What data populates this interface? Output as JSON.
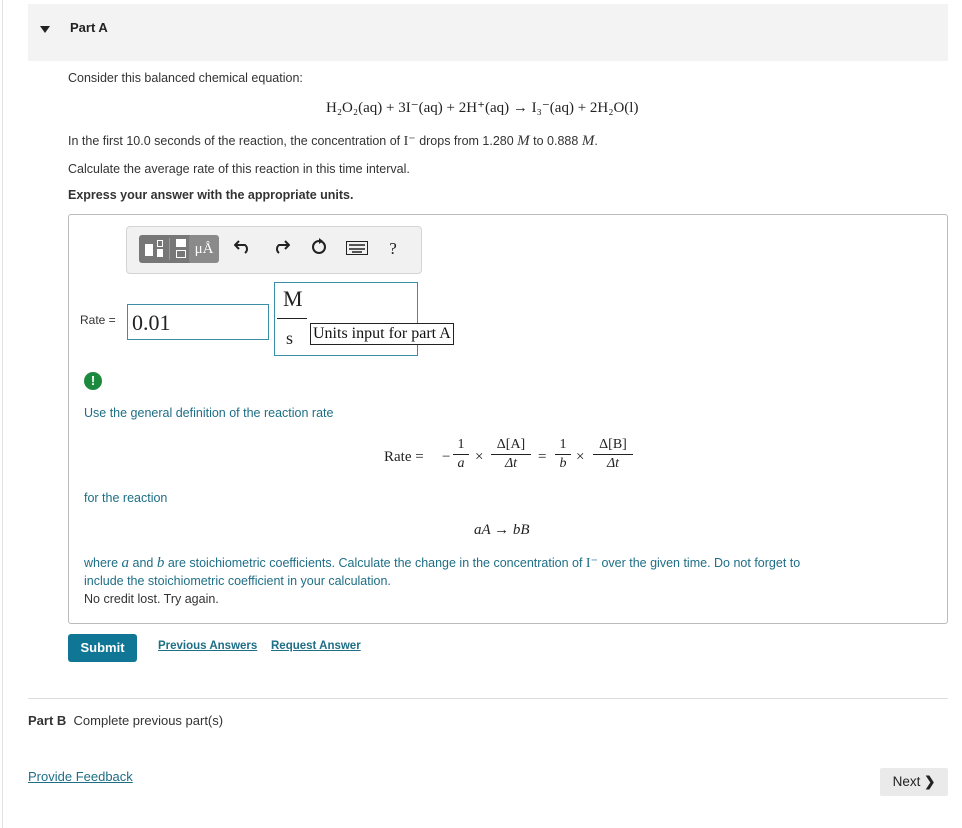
{
  "part_a": {
    "label": "Part A",
    "intro": "Consider this balanced chemical equation:",
    "equation": "H₂O₂(aq) + 3I⁻(aq) + 2H⁺(aq) → I₃⁻(aq) + 2H₂O(l)",
    "sentence_pre": "In the first 10.0 seconds of the reaction, the concentration of",
    "sentence_species": "I⁻",
    "sentence_mid": "drops from 1.280",
    "sentence_unit1": "M",
    "sentence_to": "to 0.888",
    "sentence_unit2": "M",
    "sentence_end": ".",
    "task": "Calculate the average rate of this reaction in this time interval.",
    "instruction": "Express your answer with the appropriate units."
  },
  "toolbar": {
    "units_label": "μÅ",
    "help_label": "?",
    "icons": [
      "templates-icon",
      "units-icon",
      "undo-icon",
      "redo-icon",
      "reset-icon",
      "keyboard-icon",
      "help-icon"
    ]
  },
  "answer": {
    "rate_label": "Rate =",
    "value": "0.01",
    "units_numerator": "M",
    "units_denominator": "s",
    "units_tooltip": "Units input for part A"
  },
  "feedback": {
    "hint_title": "Use the general definition of the reaction rate",
    "rate_word": "Rate =",
    "frac1_num": "1",
    "frac1_den": "a",
    "frac2_num": "Δ[A]",
    "frac2_den": "Δt",
    "frac3_num": "1",
    "frac3_den": "b",
    "frac4_num": "Δ[B]",
    "frac4_den": "Δt",
    "for_reaction": "for the reaction",
    "reaction": "aA → bB",
    "explanation_1a": "where",
    "explanation_1b": "a",
    "explanation_1c": "and",
    "explanation_1d": "b",
    "explanation_1e": "are stoichiometric coefficients. Calculate the change in the concentration of",
    "explanation_1f": "I⁻",
    "explanation_1g": "over the given time. Do not forget to",
    "explanation_2": "include the stoichiometric coefficient in your calculation.",
    "no_credit": "No credit lost. Try again."
  },
  "actions": {
    "submit": "Submit",
    "previous_answers": "Previous Answers",
    "request_answer": "Request Answer"
  },
  "part_b": {
    "label": "Part B",
    "status": "Complete previous part(s)"
  },
  "footer": {
    "provide_feedback": "Provide Feedback",
    "next": "Next"
  },
  "colors": {
    "accent": "#0f7795",
    "hint_text": "#1e6e86",
    "alert": "#1c8a3e"
  }
}
